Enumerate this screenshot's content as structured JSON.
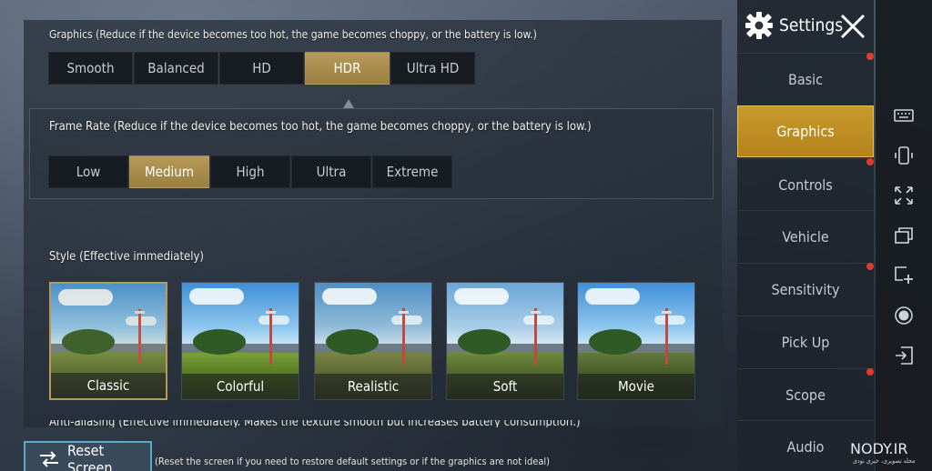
{
  "graphics": {
    "title": "Graphics (Reduce if the device becomes too hot, the game becomes choppy, or the battery is low.)",
    "options": [
      "Smooth",
      "Balanced",
      "HD",
      "HDR",
      "Ultra HD"
    ],
    "selected": "HDR"
  },
  "frame_rate": {
    "title": "Frame Rate (Reduce if the device becomes too hot, the game becomes choppy, or the battery is low.)",
    "options": [
      "Low",
      "Medium",
      "High",
      "Ultra",
      "Extreme"
    ],
    "selected": "Medium"
  },
  "style": {
    "title": "Style (Effective immediately)",
    "options": [
      "Classic",
      "Colorful",
      "Realistic",
      "Soft",
      "Movie"
    ],
    "selected": "Classic"
  },
  "anti_aliasing": {
    "title": "Anti-aliasing (Effective immediately. Makes the texture smooth but increases battery consumption.)"
  },
  "reset": {
    "label": "Reset Screen",
    "note": "(Reset the screen if you need to restore default settings or if the graphics are not ideal)"
  },
  "sidebar": {
    "title": "Settings",
    "items": [
      {
        "label": "Basic",
        "badge": true
      },
      {
        "label": "Graphics",
        "badge": true,
        "active": true
      },
      {
        "label": "Controls",
        "badge": false
      },
      {
        "label": "Vehicle",
        "badge": false
      },
      {
        "label": "Sensitivity",
        "badge": true
      },
      {
        "label": "Pick Up",
        "badge": false
      },
      {
        "label": "Scope",
        "badge": true
      },
      {
        "label": "Audio",
        "badge": false
      }
    ]
  },
  "toolbar_icons": [
    "keyboard-icon",
    "phone-rotate-icon",
    "fullscreen-icon",
    "multi-window-icon",
    "add-window-icon",
    "record-icon",
    "exit-icon"
  ],
  "watermark": {
    "text": "NODY.IR",
    "subtext": "مجله تصویری، خبری نودی"
  },
  "colors": {
    "accent_gold": "#b59a5a",
    "nav_active": "#c79a2c",
    "badge_red": "#e23a2e",
    "reset_border": "#5da8c8"
  }
}
